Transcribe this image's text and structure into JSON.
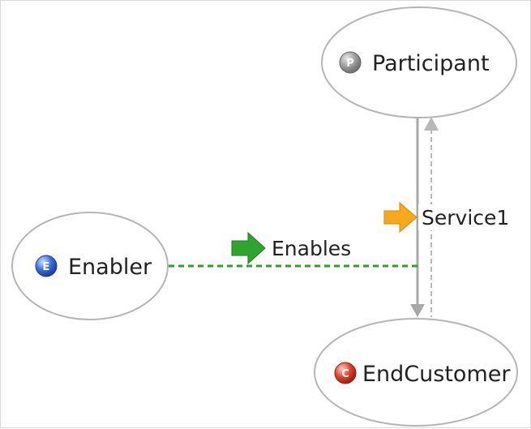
{
  "diagram": {
    "nodes": {
      "participant": {
        "label": "Participant",
        "badge": "P",
        "badge_color": "#8a8a8a"
      },
      "enabler": {
        "label": "Enabler",
        "badge": "E",
        "badge_color": "#3a63c8"
      },
      "end_customer": {
        "label": "EndCustomer",
        "badge": "C",
        "badge_color": "#d63a2a"
      }
    },
    "edges": {
      "enables": {
        "label": "Enables",
        "icon": "green-arrow-icon",
        "color": "#2f9e2f"
      },
      "service1": {
        "label": "Service1",
        "icon": "orange-arrow-icon",
        "color": "#f5a21a"
      }
    },
    "colors": {
      "node_border": "#b5b5b5",
      "connector": "#aaaaaa",
      "enables_line": "#2f9e2f"
    }
  }
}
